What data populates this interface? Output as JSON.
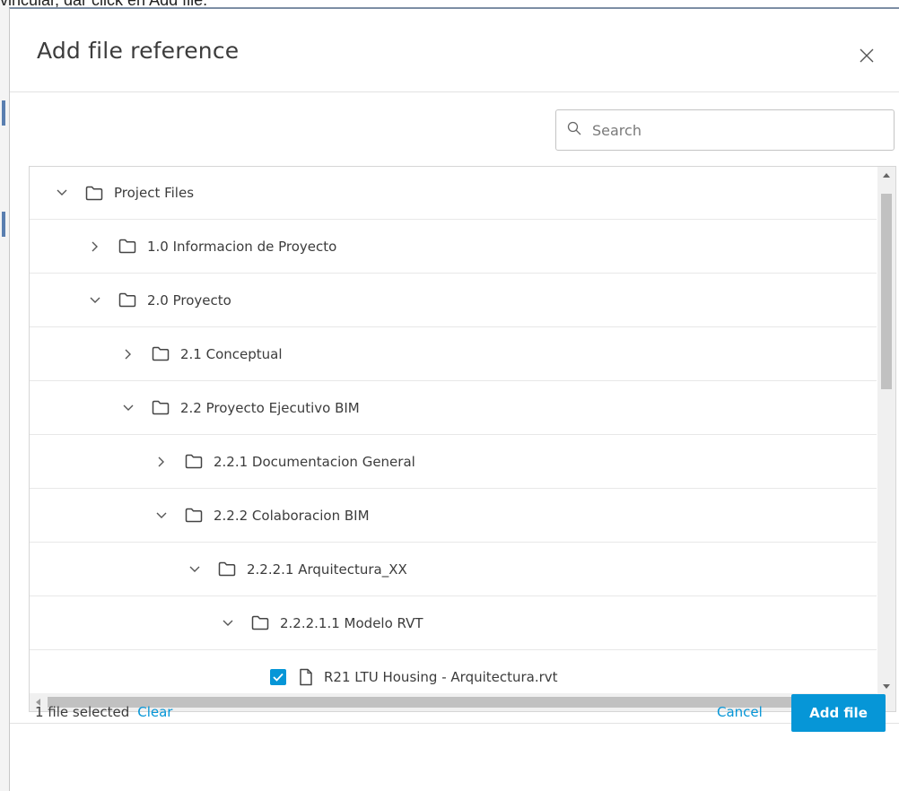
{
  "background": {
    "instruction_text": "vincular, dar click en Add file."
  },
  "dialog": {
    "title": "Add file reference",
    "close_icon": "close-icon",
    "search": {
      "placeholder": "Search",
      "value": ""
    },
    "tree": {
      "rows": [
        {
          "label": "Project Files",
          "expanded": true,
          "type": "folder",
          "depth": 0
        },
        {
          "label": "1.0 Informacion de Proyecto",
          "expanded": false,
          "type": "folder",
          "depth": 1
        },
        {
          "label": "2.0 Proyecto",
          "expanded": true,
          "type": "folder",
          "depth": 1
        },
        {
          "label": "2.1 Conceptual",
          "expanded": false,
          "type": "folder",
          "depth": 2
        },
        {
          "label": "2.2 Proyecto Ejecutivo BIM",
          "expanded": true,
          "type": "folder",
          "depth": 2
        },
        {
          "label": "2.2.1 Documentacion General",
          "expanded": false,
          "type": "folder",
          "depth": 3
        },
        {
          "label": "2.2.2 Colaboracion BIM",
          "expanded": true,
          "type": "folder",
          "depth": 3
        },
        {
          "label": "2.2.2.1 Arquitectura_XX",
          "expanded": true,
          "type": "folder",
          "depth": 4
        },
        {
          "label": "2.2.2.1.1 Modelo RVT",
          "expanded": true,
          "type": "folder",
          "depth": 5
        },
        {
          "label": "R21 LTU Housing - Arquitectura.rvt",
          "type": "file",
          "checked": true,
          "depth": 6
        }
      ]
    },
    "footer": {
      "selected_text": "1 file selected",
      "clear_label": "Clear",
      "cancel_label": "Cancel",
      "add_label": "Add file"
    }
  },
  "colors": {
    "accent": "#0696d7",
    "text": "#3c3c3c",
    "border": "#d6d6d6"
  }
}
